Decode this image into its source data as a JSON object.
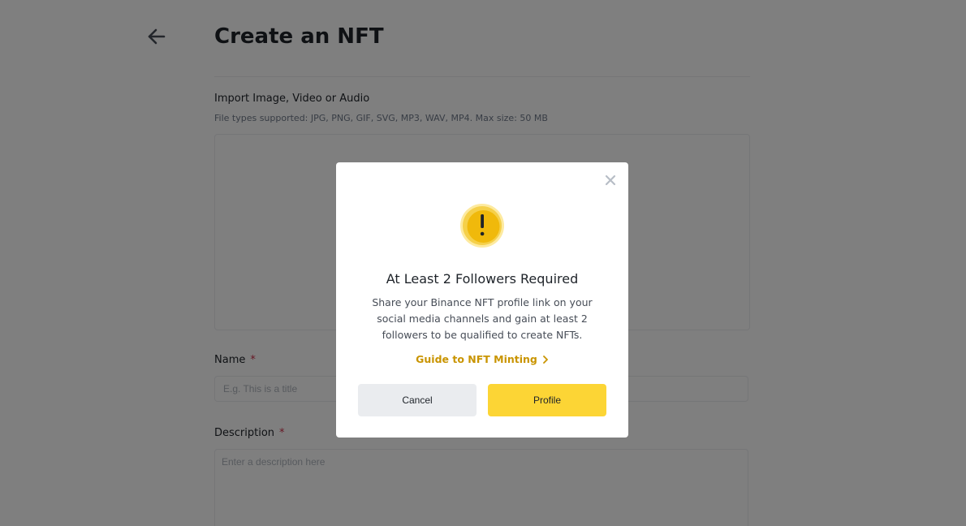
{
  "page": {
    "title": "Create an NFT",
    "upload_label": "Import Image, Video or Audio",
    "upload_hint": "File types supported: JPG, PNG, GIF, SVG, MP3, WAV, MP4. Max size: 50 MB",
    "name_label": "Name",
    "name_required_mark": "*",
    "name_placeholder": "E.g. This is a title",
    "description_label": "Description",
    "description_required_mark": "*",
    "description_placeholder": "Enter a description here"
  },
  "modal": {
    "icon": "exclamation-warning-icon",
    "title": "At Least 2 Followers Required",
    "text": "Share your Binance NFT profile link on your social media channels and gain at least 2 followers to be qualified to create NFTs.",
    "guide_link": "Guide to NFT Minting",
    "cancel_label": "Cancel",
    "profile_label": "Profile"
  },
  "colors": {
    "accent": "#fcd535",
    "link": "#c99400",
    "required": "#cf304a",
    "overlay": "rgba(0,0,0,0.5)"
  }
}
